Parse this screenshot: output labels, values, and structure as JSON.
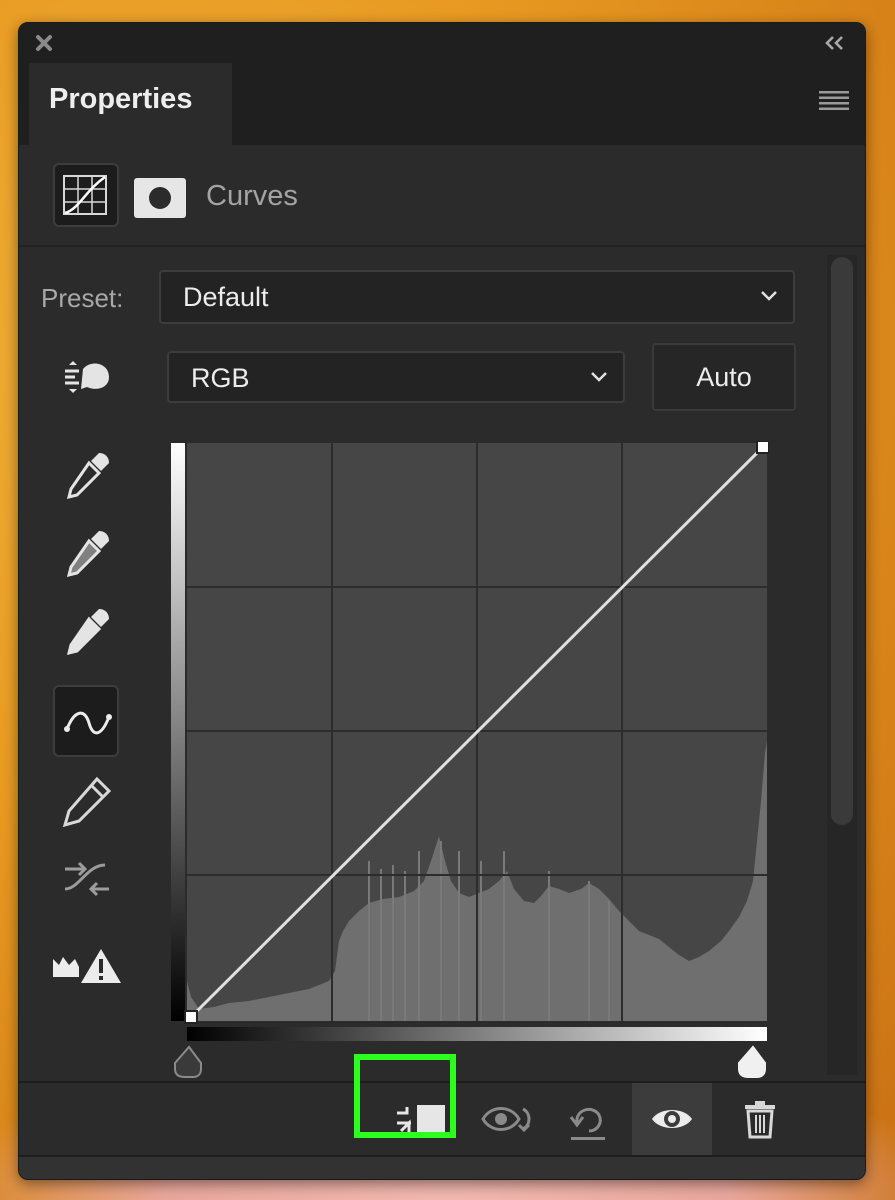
{
  "panel": {
    "tab_title": "Properties",
    "adjustment_name": "Curves"
  },
  "preset": {
    "label": "Preset:",
    "value": "Default"
  },
  "channel": {
    "value": "RGB"
  },
  "auto_button": {
    "label": "Auto"
  },
  "tools": [
    {
      "name": "on-image-adjustment-icon"
    },
    {
      "name": "black-point-eyedropper-icon"
    },
    {
      "name": "gray-point-eyedropper-icon"
    },
    {
      "name": "white-point-eyedropper-icon"
    },
    {
      "name": "curve-edit-points-icon",
      "active": true
    },
    {
      "name": "pencil-draw-icon"
    },
    {
      "name": "smooth-curve-icon"
    },
    {
      "name": "clipping-warning-icon"
    }
  ],
  "footer_buttons": [
    {
      "name": "clip-to-layer-icon",
      "highlighted": true
    },
    {
      "name": "view-previous-state-icon"
    },
    {
      "name": "reset-adjustment-icon"
    },
    {
      "name": "toggle-visibility-icon",
      "active": true
    },
    {
      "name": "delete-adjustment-icon"
    }
  ],
  "colors": {
    "panel_bg": "#2b2b2b",
    "highlight": "#2bff1c"
  }
}
